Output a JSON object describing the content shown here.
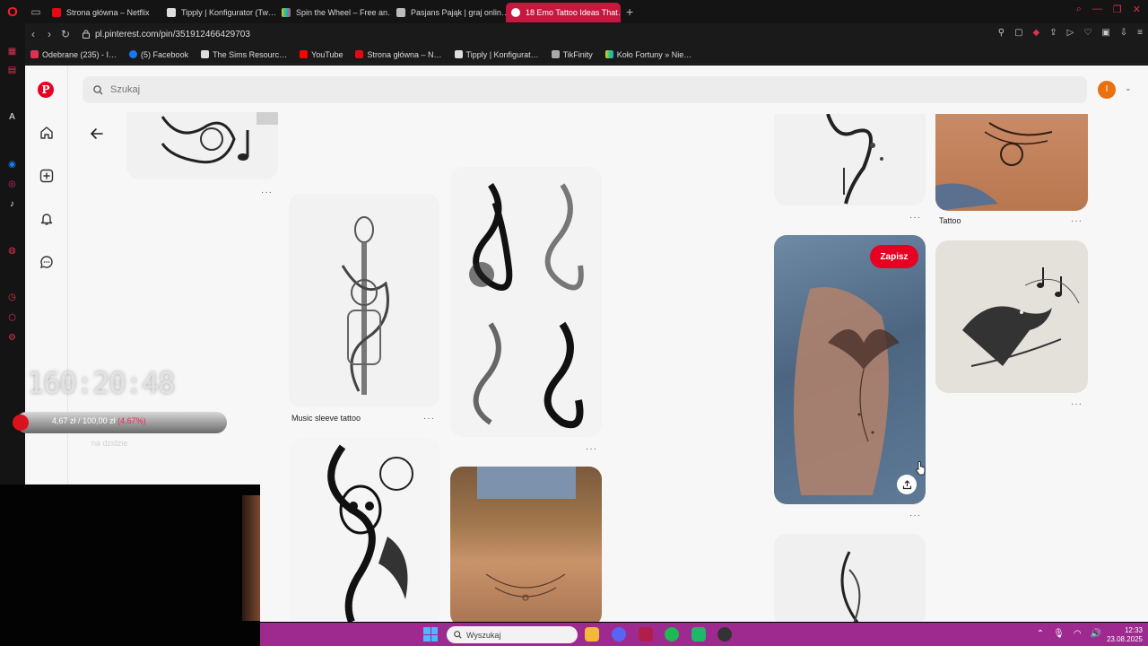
{
  "browser": {
    "tabs": [
      {
        "label": "Strona główna – Netflix",
        "color": "#e50914"
      },
      {
        "label": "Tipply | Konfigurator (Tw…",
        "color": "#dddddd"
      },
      {
        "label": "Spin the Wheel – Free an…",
        "color": "#f5c518"
      },
      {
        "label": "Pasjans Pająk | graj onlin…",
        "color": "#bbbbbb"
      },
      {
        "label": "18 Emo Tattoo Ideas That…",
        "color": "#e60023"
      }
    ],
    "new_tab": "+",
    "url": "pl.pinterest.com/pin/351912466429703",
    "bookmarks": [
      {
        "label": "Odebrane (235) - I…",
        "color": "#e0304f"
      },
      {
        "label": "(5) Facebook",
        "color": "#1877f2"
      },
      {
        "label": "The Sims Resourc…",
        "color": "#dddddd"
      },
      {
        "label": "YouTube",
        "color": "#ff0000"
      },
      {
        "label": "Strona główna – N…",
        "color": "#e50914"
      },
      {
        "label": "Tipply | Konfigurat…",
        "color": "#dddddd"
      },
      {
        "label": "TikFinity",
        "color": "#aaaaaa"
      },
      {
        "label": "Koło Fortuny » Nie…",
        "color": "#f5c518"
      }
    ]
  },
  "pinterest": {
    "search_placeholder": "Szukaj",
    "avatar_initial": "I",
    "save_label": "Zapisz",
    "labels": {
      "music_sleeve": "Music sleeve tattoo",
      "tattoo": "Tattoo"
    },
    "more": "···"
  },
  "overlay": {
    "timer": "160:20:48",
    "donation_current": "4,67 zł",
    "donation_sep": "/",
    "donation_goal": "100,00 zł",
    "donation_pct": "(4,67%)",
    "donation_sub": "na dzidzie"
  },
  "taskbar": {
    "search_placeholder": "Wyszukaj",
    "time": "12:33",
    "date": "23.08.2025"
  }
}
